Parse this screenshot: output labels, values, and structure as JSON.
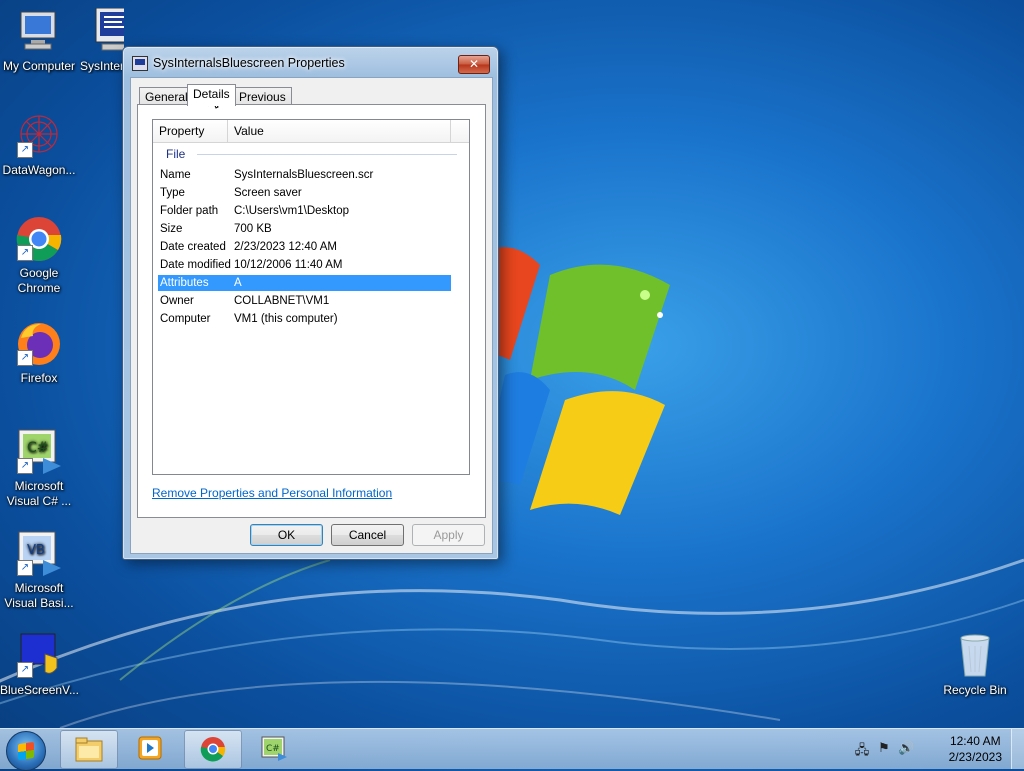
{
  "desktop": {
    "icons": [
      {
        "label": "My Computer"
      },
      {
        "label": "SysInternals..."
      },
      {
        "label": "DataWagon..."
      },
      {
        "label": "Google Chrome"
      },
      {
        "label": "Firefox"
      },
      {
        "label": "Microsoft Visual C# ..."
      },
      {
        "label": "Microsoft Visual Basi..."
      },
      {
        "label": "BlueScreenV..."
      },
      {
        "label": "Recycle Bin"
      }
    ],
    "icon_top_fragment": "SysInter"
  },
  "dialog": {
    "title": "SysInternalsBluescreen Properties",
    "close_glyph": "✕",
    "tabs": [
      "General",
      "Details",
      "Previous Versions"
    ],
    "active_tab": "Details",
    "columns": [
      "Property",
      "Value"
    ],
    "group": "File",
    "rows": [
      {
        "key": "Name",
        "value": "SysInternalsBluescreen.scr"
      },
      {
        "key": "Type",
        "value": "Screen saver"
      },
      {
        "key": "Folder path",
        "value": "C:\\Users\\vm1\\Desktop"
      },
      {
        "key": "Size",
        "value": "700 KB"
      },
      {
        "key": "Date created",
        "value": "2/23/2023 12:40 AM"
      },
      {
        "key": "Date modified",
        "value": "10/12/2006 11:40 AM"
      },
      {
        "key": "Attributes",
        "value": "A"
      },
      {
        "key": "Owner",
        "value": "COLLABNET\\VM1"
      },
      {
        "key": "Computer",
        "value": "VM1 (this computer)"
      }
    ],
    "selected_row": "Attributes",
    "link": "Remove Properties and Personal Information",
    "buttons": {
      "ok": "OK",
      "cancel": "Cancel",
      "apply": "Apply"
    }
  },
  "taskbar": {
    "clock_time": "12:40 AM",
    "clock_date": "2/23/2023",
    "items": [
      "explorer-icon",
      "media-player-icon",
      "chrome-icon",
      "visual-csharp-icon"
    ]
  },
  "colors": {
    "selection": "#3399ff",
    "link": "#0066cc",
    "group_header": "#1e3287"
  }
}
